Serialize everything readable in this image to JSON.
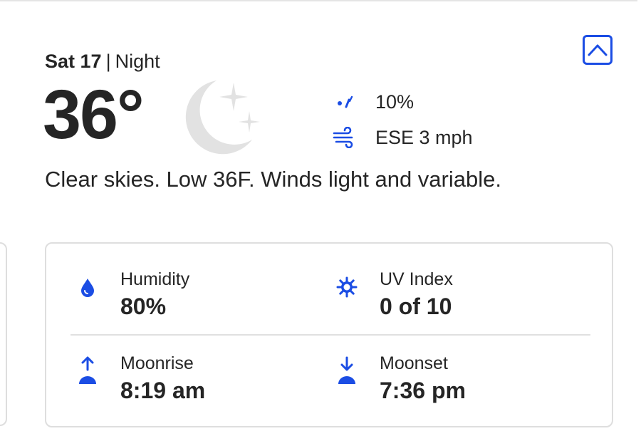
{
  "colors": {
    "accent": "#1b4de4",
    "text": "#252525",
    "moon": "#e2e2e2",
    "border": "#dedede"
  },
  "header": {
    "day": "Sat 17",
    "separator": "|",
    "period": "Night",
    "collapse_icon": "chevron-up-icon"
  },
  "current": {
    "temperature": "36°",
    "condition_icon": "clear-night-moon-icon",
    "precip_icon": "rain-drops-icon",
    "precip_chance": "10%",
    "wind_icon": "wind-icon",
    "wind": "ESE 3 mph",
    "narrative": "Clear skies. Low 36F. Winds light and variable."
  },
  "details": {
    "humidity": {
      "icon": "humidity-drop-icon",
      "label": "Humidity",
      "value": "80%"
    },
    "uv_index": {
      "icon": "uv-sun-icon",
      "label": "UV Index",
      "value": "0 of 10"
    },
    "moonrise": {
      "icon": "moonrise-icon",
      "label": "Moonrise",
      "value": "8:19 am"
    },
    "moonset": {
      "icon": "moonset-icon",
      "label": "Moonset",
      "value": "7:36 pm"
    }
  }
}
